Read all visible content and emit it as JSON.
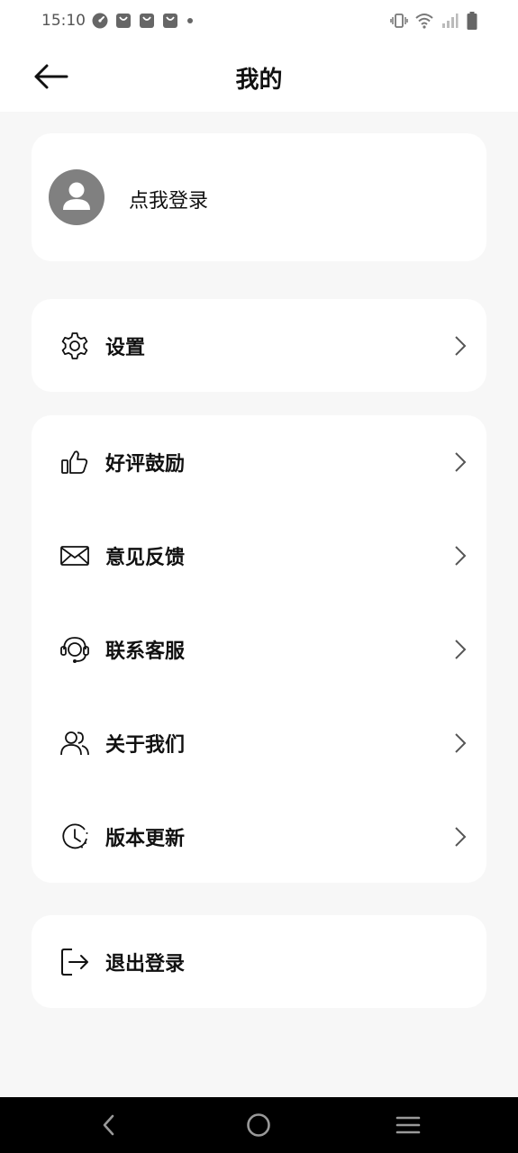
{
  "status_bar": {
    "time": "15:10",
    "left_icons": [
      "speedometer-icon",
      "shopping-bag-icon",
      "shopping-bag-icon",
      "shopping-bag-icon",
      "dot-icon"
    ],
    "right_icons": [
      "vibrate-icon",
      "wifi-icon",
      "signal-icon",
      "battery-icon"
    ]
  },
  "header": {
    "title": "我的",
    "back_icon": "arrow-left-icon"
  },
  "profile": {
    "login_text": "点我登录",
    "avatar_icon": "person-icon",
    "avatar_color": "#808080"
  },
  "settings": {
    "label": "设置",
    "icon": "gear-icon"
  },
  "menu_items": [
    {
      "label": "好评鼓励",
      "icon": "thumbs-up-icon"
    },
    {
      "label": "意见反馈",
      "icon": "envelope-icon"
    },
    {
      "label": "联系客服",
      "icon": "headset-icon"
    },
    {
      "label": "关于我们",
      "icon": "users-icon"
    },
    {
      "label": "版本更新",
      "icon": "clock-icon"
    }
  ],
  "logout": {
    "label": "退出登录",
    "icon": "logout-icon"
  },
  "nav_bar": {
    "buttons": [
      "back-triangle-icon",
      "home-circle-icon",
      "menu-lines-icon"
    ]
  },
  "colors": {
    "background": "#f7f7f7",
    "card": "#ffffff",
    "text": "#111111",
    "chevron": "#555555"
  }
}
